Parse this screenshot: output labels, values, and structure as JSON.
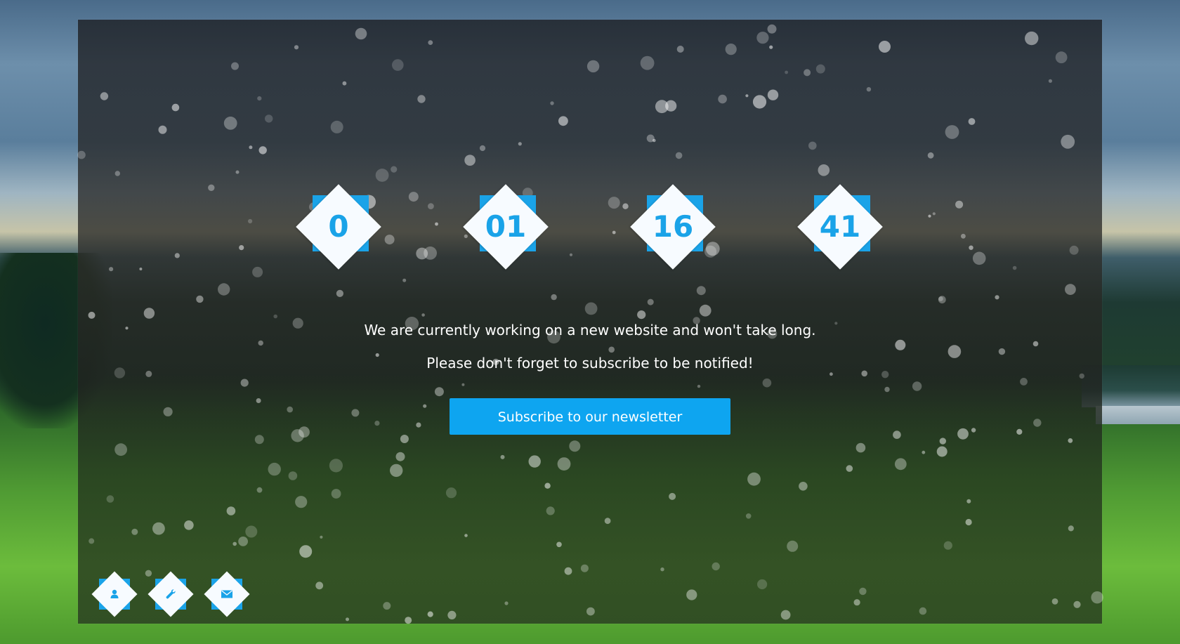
{
  "countdown": {
    "days": "0",
    "hours": "01",
    "minutes": "16",
    "seconds": "41"
  },
  "message": {
    "line1": "We are currently working on a new website and won't take long.",
    "line2": "Please don't forget to subscribe to be notified!"
  },
  "subscribe": {
    "label": "Subscribe to our newsletter"
  },
  "social": [
    {
      "icon": "user-icon"
    },
    {
      "icon": "wrench-icon"
    },
    {
      "icon": "envelope-icon"
    }
  ],
  "colors": {
    "accent": "#1aa3e8",
    "button": "#0ea5f0",
    "panel": "#2a2c2e",
    "text": "#ffffff"
  }
}
